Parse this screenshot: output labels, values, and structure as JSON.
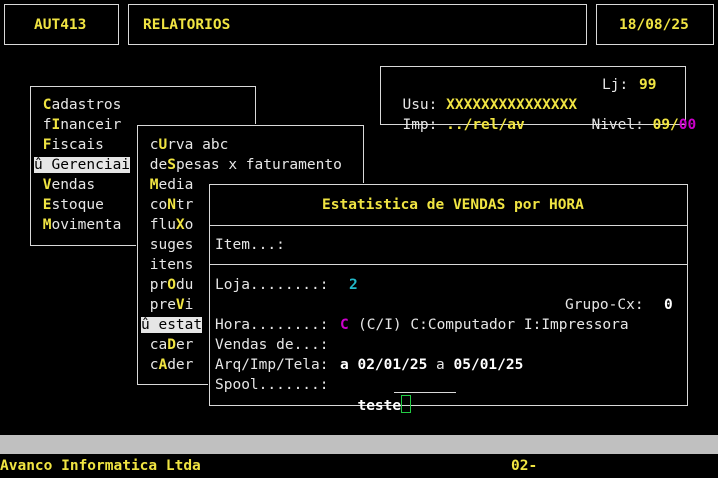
{
  "header": {
    "program_code": "AUT413",
    "title": "RELATORIOS",
    "date": "18/08/25"
  },
  "user_panel": {
    "usu_label": "Usu:",
    "usu_value": "XXXXXXXXXXXXXXX",
    "lj_label": "Lj:",
    "lj_value": "99",
    "imp_label": "Imp:",
    "imp_value": "../rel/av",
    "nivel_label": "Nivel:",
    "nivel_value_a": "09/",
    "nivel_value_b": "00"
  },
  "main_menu": [
    {
      "pre": " ",
      "hot": "C",
      "post": "adastros"
    },
    {
      "pre": " f",
      "hot": "I",
      "post": "nanceir"
    },
    {
      "pre": " ",
      "hot": "F",
      "post": "iscais"
    },
    {
      "pre": "û ",
      "hot": "G",
      "post": "erenciai",
      "selected": true
    },
    {
      "pre": " ",
      "hot": "V",
      "post": "endas"
    },
    {
      "pre": " ",
      "hot": "E",
      "post": "stoque"
    },
    {
      "pre": " ",
      "hot": "M",
      "post": "ovimenta"
    }
  ],
  "sub_menu": [
    {
      "pre": " c",
      "hot": "U",
      "post": "rva abc"
    },
    {
      "pre": " de",
      "hot": "S",
      "post": "pesas x faturamento"
    },
    {
      "pre": " ",
      "hot": "M",
      "post": "edia"
    },
    {
      "pre": " co",
      "hot": "N",
      "post": "tr"
    },
    {
      "pre": " flu",
      "hot": "X",
      "post": "o"
    },
    {
      "pre": " suges",
      "hot": "",
      "post": ""
    },
    {
      "pre": " itens",
      "hot": "",
      "post": ""
    },
    {
      "pre": " pr",
      "hot": "O",
      "post": "du"
    },
    {
      "pre": " pre",
      "hot": "V",
      "post": "i"
    },
    {
      "pre": "û estat",
      "hot": "",
      "post": "",
      "selected": true
    },
    {
      "pre": " ca",
      "hot": "D",
      "post": "er"
    },
    {
      "pre": " c",
      "hot": "A",
      "post": "der"
    }
  ],
  "dialog": {
    "title": "Estatistica de VENDAS por HORA",
    "item_label": "Item...:",
    "loja_label": "Loja........:",
    "loja_value": "2",
    "grupo_label": "Grupo-Cx:",
    "grupo_value": "0",
    "hora_label": "Hora........:",
    "hora_value": "C",
    "hora_hint": "(C/I) C:Computador I:Impressora",
    "vendas_label": "Vendas de...:",
    "vendas_from": "02/01/25",
    "vendas_sep": "a",
    "vendas_to": "05/01/25",
    "arq_label": "Arq/Imp/Tela:",
    "arq_value": "a",
    "spool_label": "Spool.......:",
    "spool_value": "teste"
  },
  "status_bar": {
    "company": "Avanco Informatica Ltda",
    "page": "02-"
  }
}
